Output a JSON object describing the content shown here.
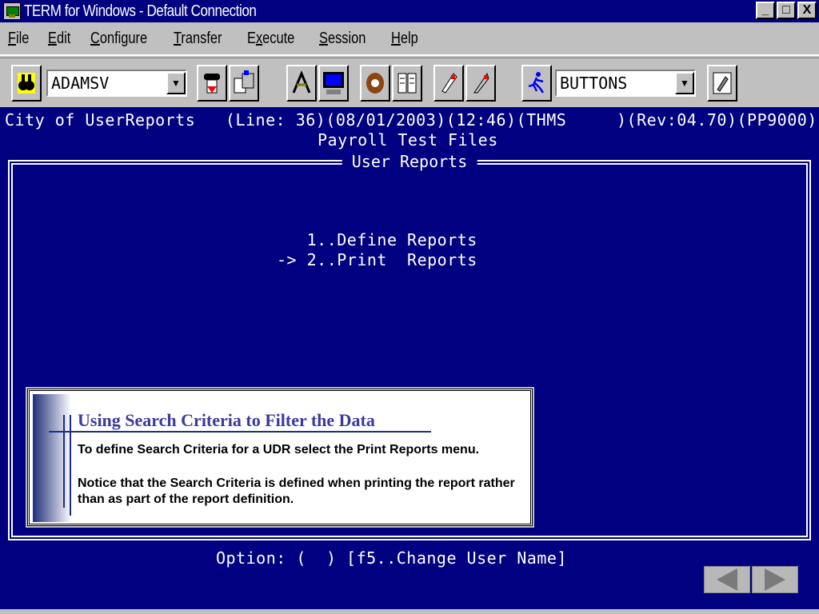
{
  "window": {
    "title": "TERM for Windows - Default Connection",
    "minimize": "_",
    "maximize": "□",
    "close": "X"
  },
  "menu": [
    "File",
    "Edit",
    "Configure",
    "Transfer",
    "Execute",
    "Session",
    "Help"
  ],
  "menu_underline": [
    "F",
    "E",
    "C",
    "T",
    "x",
    "S",
    "H"
  ],
  "toolbar": {
    "user_combo": "ADAMSV",
    "buttons_combo": "BUTTONS",
    "icons": [
      "binoculars-icon",
      "phone-hangup-icon",
      "copy-icon",
      "connect-icon",
      "computer-icon",
      "baseball-glove-icon",
      "book-icon",
      "pencil-icon",
      "quill-icon",
      "runner-icon",
      "pencil-button-icon"
    ]
  },
  "terminal": {
    "status_line": "City of UserReports   (Line: 36)(08/01/2003)(12:46)(THMS     )(Rev:04.70)(PP9000)",
    "subtitle": "Payroll Test Files",
    "box_title": "User Reports",
    "menu_items": [
      "   1..Define Reports",
      "-> 2..Print  Reports"
    ],
    "option_line": "Option: (  ) [f5..Change User Name]"
  },
  "info_panel": {
    "title": "Using Search Criteria to Filter the Data",
    "paragraph1": "To define Search Criteria for a UDR select the Print Reports menu.",
    "paragraph2": "Notice that the Search Criteria is defined when printing the report rather than as part of the report definition."
  },
  "colors": {
    "terminal_bg": "#000080",
    "title_bar": "#000080",
    "chrome": "#c0c0c0",
    "info_title": "#3a3aa0"
  }
}
